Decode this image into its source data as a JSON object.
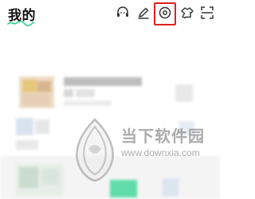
{
  "header": {
    "title": "我的",
    "icons": [
      "headset-icon",
      "edit-icon",
      "settings-icon",
      "theme-icon",
      "scan-icon"
    ],
    "highlight_color": "#e02020"
  },
  "watermark": {
    "cn_text": "当下软件园",
    "url_text": "www.downxia.com"
  }
}
